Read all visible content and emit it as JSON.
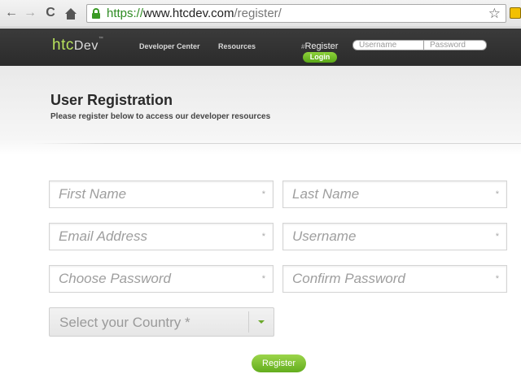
{
  "browser": {
    "url_scheme": "https://",
    "url_host": "www.htcdev.com",
    "url_path": "/register/",
    "back_glyph": "←",
    "forward_glyph": "→",
    "reload_glyph": "C",
    "star_glyph": "☆",
    "icons": [
      "back-arrow-icon",
      "forward-arrow-icon",
      "reload-icon",
      "home-icon",
      "lock-icon",
      "star-icon",
      "extension-icon"
    ]
  },
  "header": {
    "logo_main": "htc",
    "logo_dev": "Dev",
    "logo_tm": "™",
    "nav": [
      "Developer Center",
      "Resources"
    ],
    "register_hash": "#",
    "register_label": "Register",
    "login_label": "Login",
    "username_placeholder": "Username",
    "password_placeholder": "Password",
    "accent_color": "#6ab31f"
  },
  "main": {
    "title": "User Registration",
    "subtitle": "Please register below to access our developer resources",
    "fields": {
      "first_name": "First Name",
      "last_name": "Last Name",
      "email": "Email Address",
      "username": "Username",
      "password": "Choose Password",
      "confirm_password": "Confirm Password"
    },
    "required_marker": "*",
    "country_select": "Select your Country *",
    "register_button": "Register"
  }
}
